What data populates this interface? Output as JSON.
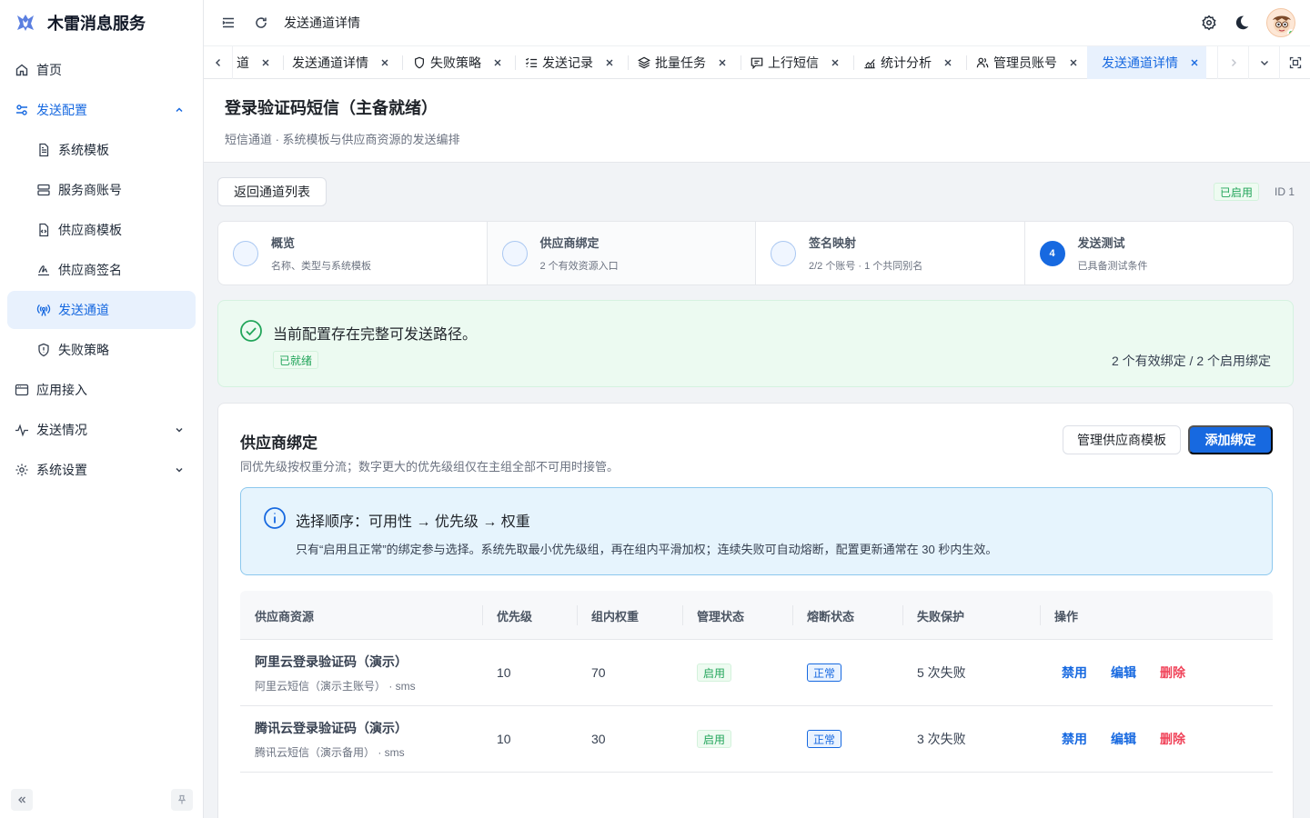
{
  "app": {
    "title": "木雷消息服务"
  },
  "sidebar": {
    "items": [
      {
        "label": "首页",
        "icon": "home-icon"
      },
      {
        "label": "发送配置",
        "icon": "sliders-icon"
      },
      {
        "label": "系统模板",
        "icon": "document-icon"
      },
      {
        "label": "服务商账号",
        "icon": "server-icon"
      },
      {
        "label": "供应商模板",
        "icon": "file-code-icon"
      },
      {
        "label": "供应商签名",
        "icon": "signature-icon"
      },
      {
        "label": "发送通道",
        "icon": "broadcast-icon"
      },
      {
        "label": "失败策略",
        "icon": "shield-icon"
      },
      {
        "label": "应用接入",
        "icon": "app-window-icon"
      },
      {
        "label": "发送情况",
        "icon": "activity-icon"
      },
      {
        "label": "系统设置",
        "icon": "settings-icon"
      }
    ]
  },
  "header": {
    "title": "发送通道详情"
  },
  "tabs": [
    {
      "label": "道"
    },
    {
      "label": "发送通道详情"
    },
    {
      "label": "失败策略",
      "icon": "shield-icon"
    },
    {
      "label": "发送记录",
      "icon": "list-check-icon"
    },
    {
      "label": "批量任务",
      "icon": "layers-icon"
    },
    {
      "label": "上行短信",
      "icon": "message-icon"
    },
    {
      "label": "统计分析",
      "icon": "chart-icon"
    },
    {
      "label": "管理员账号",
      "icon": "users-icon"
    },
    {
      "label": "发送通道详情"
    }
  ],
  "page": {
    "title": "登录验证码短信（主备就绪）",
    "subtitle": "短信通道 · 系统模板与供应商资源的发送编排",
    "back_label": "返回通道列表",
    "status": "已启用",
    "id_label": "ID 1"
  },
  "steps": [
    {
      "title": "概览",
      "desc": "名称、类型与系统模板",
      "num": ""
    },
    {
      "title": "供应商绑定",
      "desc": "2 个有效资源入口",
      "num": ""
    },
    {
      "title": "签名映射",
      "desc": "2/2 个账号 · 1 个共同别名",
      "num": ""
    },
    {
      "title": "发送测试",
      "desc": "已具备测试条件",
      "num": "4"
    }
  ],
  "ready": {
    "message": "当前配置存在完整可发送路径。",
    "tag": "已就绪",
    "summary": "2 个有效绑定 / 2 个启用绑定"
  },
  "binding": {
    "title": "供应商绑定",
    "subtitle": "同优先级按权重分流；数字更大的优先级组仅在主组全部不可用时接管。",
    "manage_label": "管理供应商模板",
    "add_label": "添加绑定",
    "info_title": "选择顺序：可用性 → 优先级 → 权重",
    "info_body": "只有“启用且正常”的绑定参与选择。系统先取最小优先级组，再在组内平滑加权；连续失败可自动熔断，配置更新通常在 30 秒内生效。",
    "columns": [
      "供应商资源",
      "优先级",
      "组内权重",
      "管理状态",
      "熔断状态",
      "失败保护",
      "操作"
    ],
    "rows": [
      {
        "name": "阿里云登录验证码（演示）",
        "sub": "阿里云短信（演示主账号） · sms",
        "priority": "10",
        "weight": "70",
        "admin": "启用",
        "breaker": "正常",
        "protect": "5 次失败",
        "actions": [
          "禁用",
          "编辑",
          "删除"
        ]
      },
      {
        "name": "腾讯云登录验证码（演示）",
        "sub": "腾讯云短信（演示备用） · sms",
        "priority": "10",
        "weight": "30",
        "admin": "启用",
        "breaker": "正常",
        "protect": "3 次失败",
        "actions": [
          "禁用",
          "编辑",
          "删除"
        ]
      }
    ]
  },
  "colors": {
    "primary": "#1769e0",
    "success": "#22a55a",
    "danger": "#f0445a"
  }
}
